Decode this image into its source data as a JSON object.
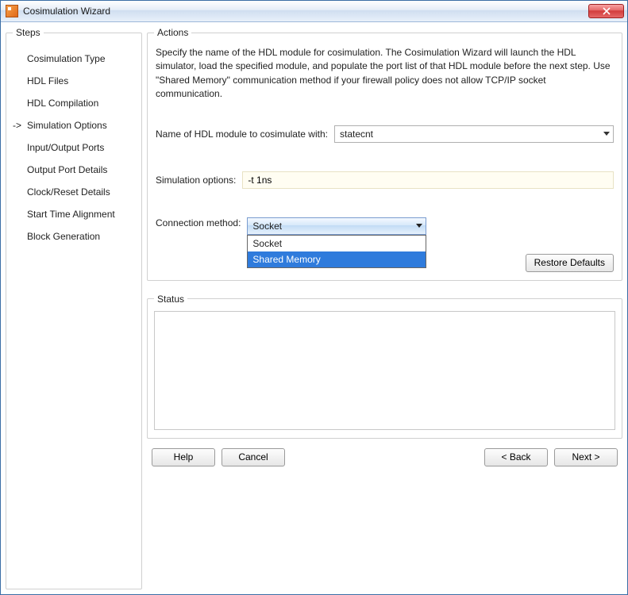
{
  "window": {
    "title": "Cosimulation Wizard"
  },
  "steps": {
    "legend": "Steps",
    "items": [
      {
        "label": "Cosimulation Type",
        "current": false
      },
      {
        "label": "HDL Files",
        "current": false
      },
      {
        "label": "HDL Compilation",
        "current": false
      },
      {
        "label": "Simulation Options",
        "current": true
      },
      {
        "label": "Input/Output Ports",
        "current": false
      },
      {
        "label": "Output Port Details",
        "current": false
      },
      {
        "label": "Clock/Reset Details",
        "current": false
      },
      {
        "label": "Start Time Alignment",
        "current": false
      },
      {
        "label": "Block Generation",
        "current": false
      }
    ]
  },
  "actions": {
    "legend": "Actions",
    "description": "Specify the name of the HDL module for cosimulation. The Cosimulation Wizard will launch the HDL simulator, load the specified module, and populate the port list of that HDL module before the next step. Use \"Shared Memory\" communication method if your firewall policy does not allow  TCP/IP socket communication.",
    "module_label": "Name of HDL module to cosimulate with:",
    "module_value": "statecnt",
    "sim_opts_label": "Simulation options:",
    "sim_opts_value": "-t 1ns",
    "conn_label": "Connection method:",
    "conn_value": "Socket",
    "conn_options": [
      "Socket",
      "Shared Memory"
    ],
    "conn_highlight_index": 1,
    "restore_label": "Restore Defaults"
  },
  "status": {
    "legend": "Status"
  },
  "footer": {
    "help": "Help",
    "cancel": "Cancel",
    "back": "< Back",
    "next": "Next >"
  }
}
